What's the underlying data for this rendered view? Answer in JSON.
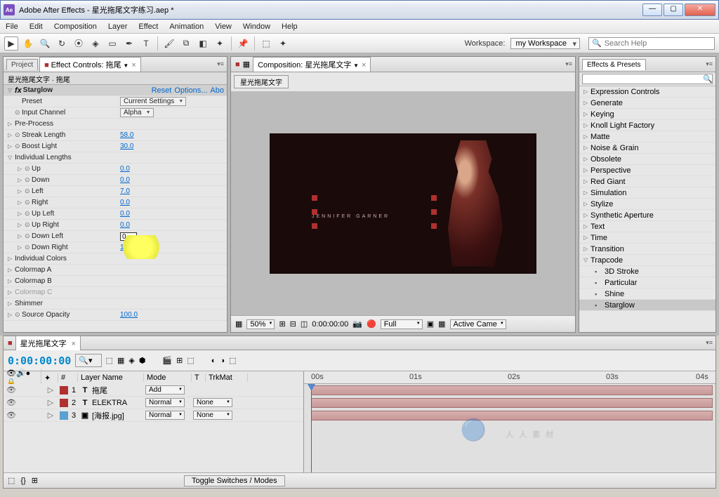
{
  "titlebar": {
    "app": "Adobe After Effects",
    "file": "星光拖尾文字练习.aep *"
  },
  "menus": [
    "File",
    "Edit",
    "Composition",
    "Layer",
    "Effect",
    "Animation",
    "View",
    "Window",
    "Help"
  ],
  "workspace": {
    "label": "Workspace:",
    "value": "my Workspace"
  },
  "search": {
    "placeholder": "Search Help"
  },
  "tabs_left": {
    "project": "Project",
    "ec": "Effect Controls: 拖尾",
    "sub": "星光拖尾文字 · 拖尾"
  },
  "fx": {
    "name": "Starglow",
    "links": {
      "reset": "Reset",
      "options": "Options...",
      "about": "Abo"
    },
    "preset_label": "Preset",
    "preset_value": "Current Settings",
    "input_label": "Input Channel",
    "input_value": "Alpha",
    "preprocess": "Pre-Process",
    "streak_label": "Streak Length",
    "streak_value": "58.0",
    "boost_label": "Boost Light",
    "boost_value": "30.0",
    "indlen": "Individual Lengths",
    "dirs": {
      "up": {
        "l": "Up",
        "v": "0.0"
      },
      "down": {
        "l": "Down",
        "v": "0.0"
      },
      "left": {
        "l": "Left",
        "v": "7.0"
      },
      "right": {
        "l": "Right",
        "v": "0.0"
      },
      "upleft": {
        "l": "Up Left",
        "v": "0.0"
      },
      "upright": {
        "l": "Up Right",
        "v": "0.0"
      },
      "downleft": {
        "l": "Down Left",
        "v": "0"
      },
      "downright": {
        "l": "Down Right",
        "v": "1.0"
      }
    },
    "indcol": "Individual Colors",
    "cmapA": "Colormap A",
    "cmapB": "Colormap B",
    "cmapC": "Colormap C",
    "shimmer": "Shimmer",
    "srcop_label": "Source Opacity",
    "srcop_value": "100.0"
  },
  "comp": {
    "tab": "Composition: 星光拖尾文字",
    "btn": "星光拖尾文字",
    "textoverlay": "JENNIFER GARNER"
  },
  "viewerbar": {
    "zoom": "50%",
    "time": "0:00:00:00",
    "res": "Full",
    "camera": "Active Came"
  },
  "ep": {
    "title": "Effects & Presets",
    "cats": [
      "Expression Controls",
      "Generate",
      "Keying",
      "Knoll Light Factory",
      "Matte",
      "Noise & Grain",
      "Obsolete",
      "Perspective",
      "Red Giant",
      "Simulation",
      "Stylize",
      "Synthetic Aperture",
      "Text",
      "Time",
      "Transition"
    ],
    "trap": "Trapcode",
    "trapItems": [
      "3D Stroke",
      "Particular",
      "Shine",
      "Starglow"
    ]
  },
  "tl": {
    "tab": "星光拖尾文字",
    "tc": "0:00:00:00",
    "cols": {
      "num": "#",
      "layer": "Layer Name",
      "mode": "Mode",
      "t": "T",
      "trk": "TrkMat"
    },
    "ruler": [
      "00s",
      "01s",
      "02s",
      "03s",
      "04s"
    ],
    "layers": [
      {
        "n": "1",
        "ico": "T",
        "name": "拖尾",
        "mode": "Add",
        "trk": "",
        "clr": "#b03030"
      },
      {
        "n": "2",
        "ico": "T",
        "name": "ELEKTRA",
        "mode": "Normal",
        "trk": "None",
        "clr": "#b03030"
      },
      {
        "n": "3",
        "ico": "▣",
        "name": "[海报.jpg]",
        "mode": "Normal",
        "trk": "None",
        "clr": "#5aa0d0"
      }
    ],
    "toggle": "Toggle Switches / Modes"
  },
  "watermark": "人人素材"
}
